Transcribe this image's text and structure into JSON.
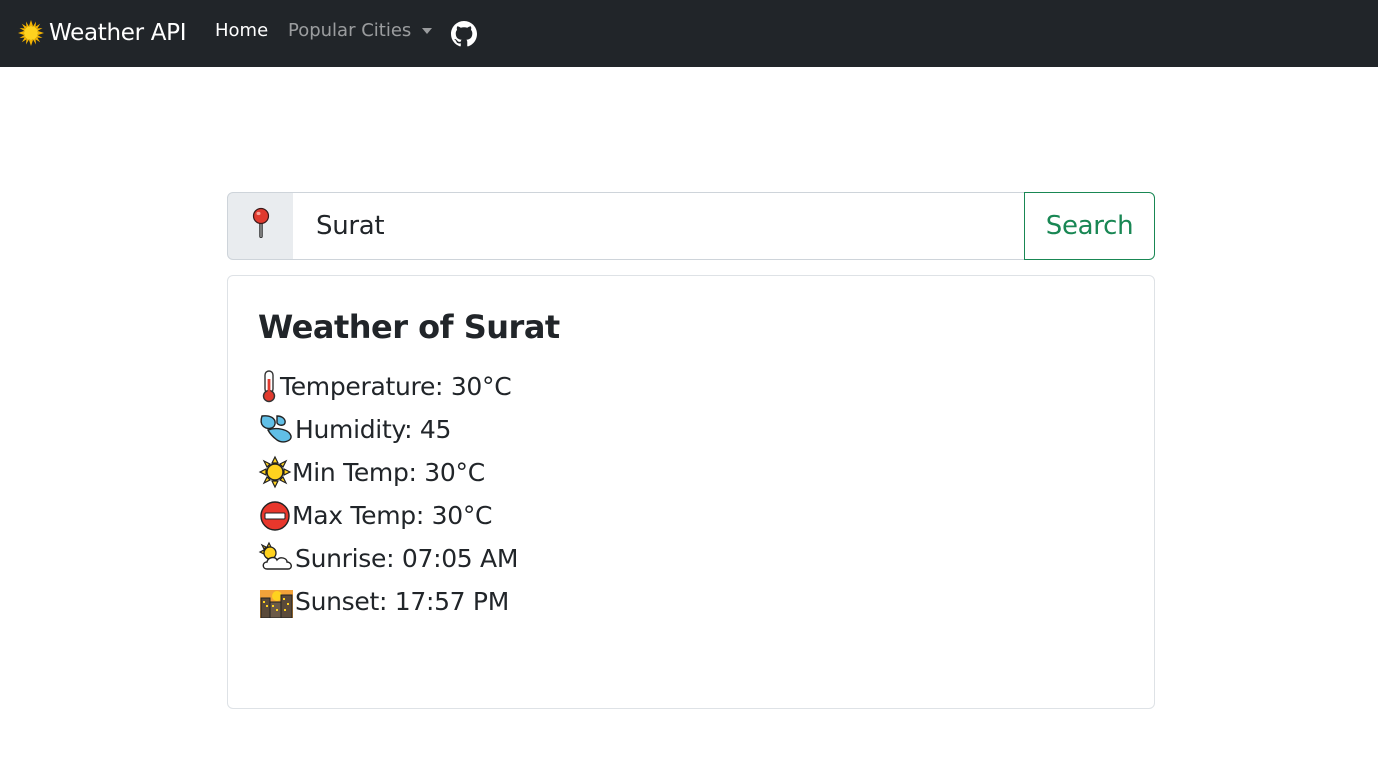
{
  "navbar": {
    "brand_icon": "sun-icon",
    "brand": "Weather API",
    "home": "Home",
    "popular_cities": "Popular Cities",
    "github_icon": "github-icon"
  },
  "search": {
    "location_icon": "pushpin-icon",
    "value": "Surat",
    "button": "Search"
  },
  "card": {
    "title": "Weather of Surat",
    "items": [
      {
        "icon": "thermometer-icon",
        "text": "Temperature: 30°C"
      },
      {
        "icon": "humidity-droplets-icon",
        "text": "Humidity: 45"
      },
      {
        "icon": "sun-outline-icon",
        "text": "Min Temp: 30°C"
      },
      {
        "icon": "no-entry-icon",
        "text": "Max Temp: 30°C"
      },
      {
        "icon": "sun-behind-cloud-icon",
        "text": "Sunrise: 07:05 AM"
      },
      {
        "icon": "city-dusk-icon",
        "text": "Sunset: 17:57 PM"
      }
    ]
  },
  "colors": {
    "navbar_bg": "#212529",
    "search_button": "#198754",
    "sun_yellow": "#ffcc00"
  }
}
